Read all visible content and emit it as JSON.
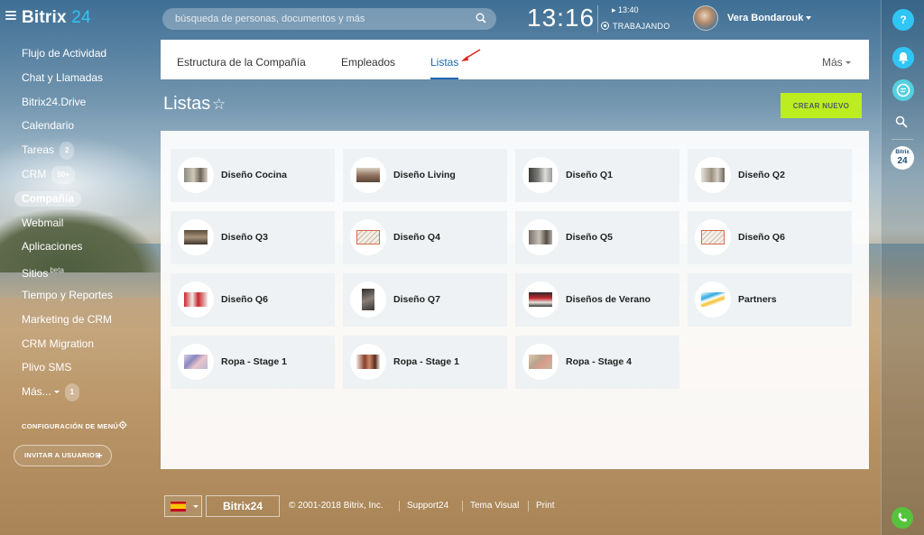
{
  "header": {
    "logo_brand": "Bitrix",
    "logo_num": "24",
    "search_placeholder": "búsqueda de personas, documentos y más",
    "clock": "13:16",
    "work_time": "13:40",
    "work_status": "TRABAJANDO",
    "username": "Vera Bondarouk"
  },
  "sidebar": {
    "items": [
      {
        "label": "Flujo de Actividad"
      },
      {
        "label": "Chat y Llamadas"
      },
      {
        "label": "Bitrix24.Drive"
      },
      {
        "label": "Calendario"
      },
      {
        "label": "Tareas",
        "counter": "2"
      },
      {
        "label": "CRM",
        "counter": "50+"
      },
      {
        "label": "Compañía"
      },
      {
        "label": "Webmail"
      },
      {
        "label": "Aplicaciones"
      },
      {
        "label": "Sitios",
        "sup": "beta"
      },
      {
        "label": "Tiempo y Reportes"
      },
      {
        "label": "Marketing de CRM"
      },
      {
        "label": "CRM Migration"
      },
      {
        "label": "Plivo SMS"
      },
      {
        "label": "Más...",
        "counter": "1"
      }
    ],
    "active_item": "Compañía",
    "config_label": "CONFIGURACIÓN DE MENÚ",
    "invite_label": "INVITAR A USUARIOS",
    "invite_plus": "+"
  },
  "tabs": {
    "items": [
      "Estructura de la Compañía",
      "Empleados",
      "Listas"
    ],
    "active": "Listas",
    "more": "Más"
  },
  "page": {
    "title": "Listas",
    "star": "☆",
    "create_button": "CREAR NUEVO"
  },
  "lists": [
    {
      "label": "Diseño Cocina",
      "thumb": "kitchen-photo"
    },
    {
      "label": "Diseño Living",
      "thumb": "living-photo"
    },
    {
      "label": "Diseño Q1",
      "thumb": "room-photo"
    },
    {
      "label": "Diseño Q2",
      "thumb": "room-photo"
    },
    {
      "label": "Diseño Q3",
      "thumb": "room-photo"
    },
    {
      "label": "Diseño Q4",
      "thumb": "document-icon"
    },
    {
      "label": "Diseño Q5",
      "thumb": "room-photo"
    },
    {
      "label": "Diseño Q6",
      "thumb": "document-icon"
    },
    {
      "label": "Diseño Q6",
      "thumb": "red-room-photo"
    },
    {
      "label": "Diseño Q7",
      "thumb": "vertical-photo"
    },
    {
      "label": "Diseños de Verano",
      "thumb": "red-room-photo"
    },
    {
      "label": "Partners",
      "thumb": "partners-icon"
    },
    {
      "label": "Ropa - Stage 1",
      "thumb": "clothing-photo"
    },
    {
      "label": "Ropa - Stage 1",
      "thumb": "clothing-photo"
    },
    {
      "label": "Ropa - Stage 4",
      "thumb": "clothing-photo"
    }
  ],
  "footer": {
    "language_flag": "es",
    "brand": "Bitrix24",
    "copyright": "© 2001-2018 Bitrix, Inc.",
    "links": [
      "Support24",
      "Tema Visual",
      "Print"
    ]
  },
  "rightrail": {
    "help": "?",
    "b24_small": "Bitrix",
    "b24_big": "24"
  },
  "colors": {
    "accent_blue": "#2fc6f6",
    "tab_active": "#2067b0",
    "create_button": "#bbed21",
    "phone_green": "#55c33c"
  }
}
